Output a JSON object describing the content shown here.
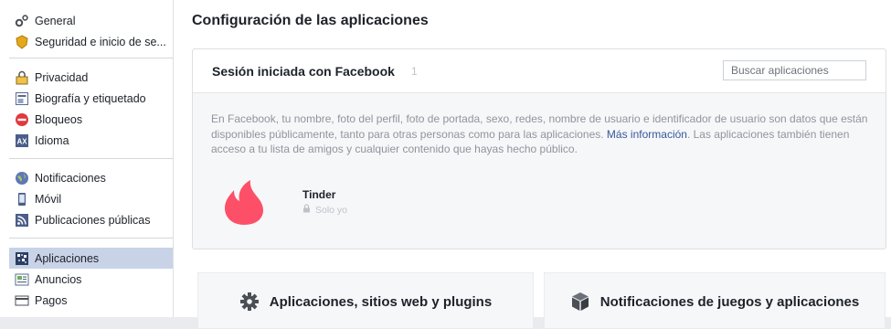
{
  "sidebar": {
    "groups": [
      [
        {
          "label": "General",
          "icon": "gears-icon"
        },
        {
          "label": "Seguridad e inicio de se...",
          "icon": "security-badge-icon"
        }
      ],
      [
        {
          "label": "Privacidad",
          "icon": "privacy-lock-icon"
        },
        {
          "label": "Biografía y etiquetado",
          "icon": "timeline-icon"
        },
        {
          "label": "Bloqueos",
          "icon": "block-icon"
        },
        {
          "label": "Idioma",
          "icon": "language-icon"
        }
      ],
      [
        {
          "label": "Notificaciones",
          "icon": "globe-icon"
        },
        {
          "label": "Móvil",
          "icon": "mobile-icon"
        },
        {
          "label": "Publicaciones públicas",
          "icon": "rss-icon"
        }
      ],
      [
        {
          "label": "Aplicaciones",
          "icon": "apps-icon",
          "active": true
        },
        {
          "label": "Anuncios",
          "icon": "ads-icon"
        },
        {
          "label": "Pagos",
          "icon": "payments-card-icon"
        }
      ]
    ]
  },
  "main": {
    "title": "Configuración de las aplicaciones",
    "panel": {
      "title": "Sesión iniciada con Facebook",
      "count": "1",
      "search_placeholder": "Buscar aplicaciones",
      "desc_before": "En Facebook, tu nombre, foto del perfil, foto de portada, sexo, redes, nombre de usuario e identificador de usuario son datos que están disponibles públicamente, tanto para otras personas como para las aplicaciones. ",
      "desc_link": "Más información",
      "desc_after": ". Las aplicaciones también tienen acceso a tu lista de amigos y cualquier contenido que hayas hecho público.",
      "apps": [
        {
          "name": "Tinder",
          "privacy": "Solo yo",
          "icon": "tinder-flame-icon",
          "color": "#fd5068"
        }
      ]
    },
    "cards": [
      {
        "label": "Aplicaciones, sitios web y plugins",
        "icon": "gear-icon"
      },
      {
        "label": "Notificaciones de juegos y aplicaciones",
        "icon": "cube-icon"
      }
    ]
  },
  "colors": {
    "accent": "#365899",
    "active_bg": "#c9d3e8",
    "panel_bg": "#f6f7f9"
  }
}
